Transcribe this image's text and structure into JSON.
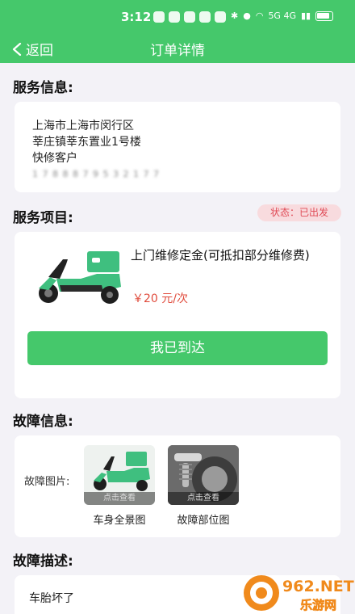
{
  "status_bar": {
    "time": "3:12",
    "signal_text": "5G 4G"
  },
  "nav": {
    "back_label": "返回",
    "title": "订单详情"
  },
  "service_info": {
    "heading": "服务信息:",
    "address_line1": "上海市上海市闵行区",
    "address_line2": "莘庄镇莘东置业1号楼",
    "customer": "快修客户",
    "phone": "1 7 8 8 8 7 9 5 3 2 1 7 7"
  },
  "service_items": {
    "heading": "服务项目:",
    "status": "状态：已出发",
    "item_name": "上门维修定金(可抵扣部分维修费)",
    "price": "￥20 元/次",
    "arrive_button": "我已到达"
  },
  "fault_info": {
    "heading": "故障信息:",
    "pic_label": "故障图片:",
    "thumbs": [
      {
        "overlay": "点击查看",
        "caption": "车身全景图"
      },
      {
        "overlay": "点击查看",
        "caption": "故障部位图"
      }
    ]
  },
  "fault_desc": {
    "heading": "故障描述:",
    "text": "车胎坏了"
  },
  "watermark": {
    "text": "962.NET",
    "sub": "乐游网"
  },
  "colors": {
    "primary": "#45c86b",
    "badge_bg": "#f8dbde",
    "badge_text": "#e04b56",
    "price": "#e04b3c"
  }
}
